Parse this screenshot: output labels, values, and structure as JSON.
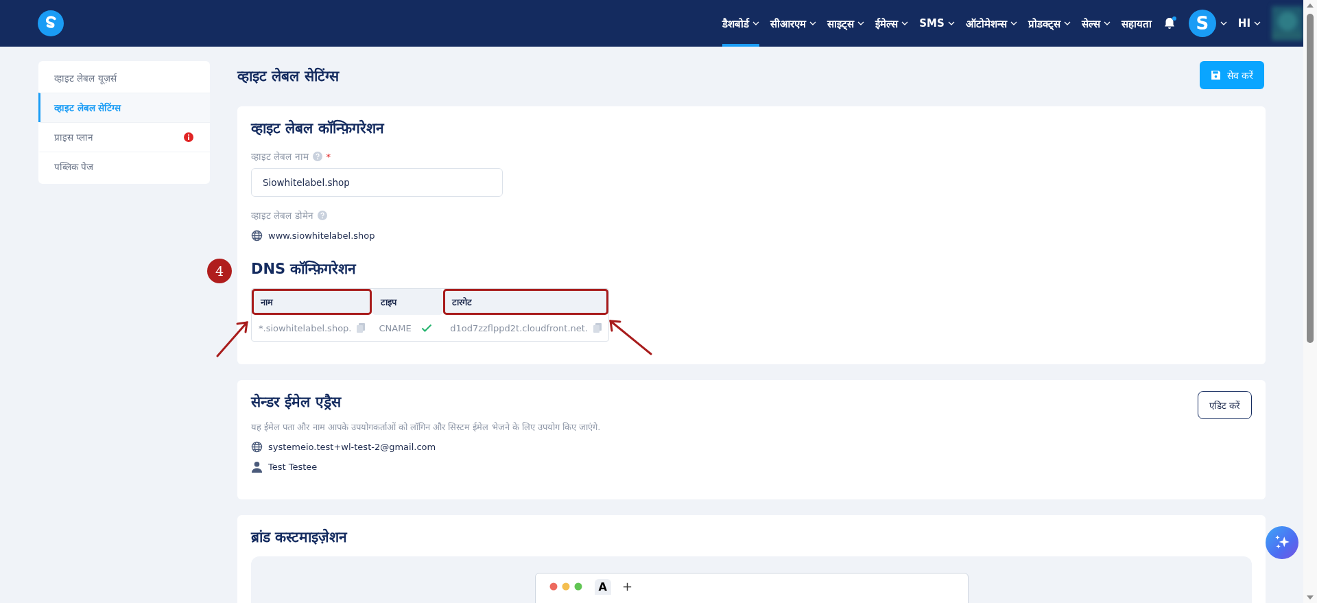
{
  "nav": {
    "items": [
      {
        "label": "डैशबोर्ड",
        "selected": true
      },
      {
        "label": "सीआरएम",
        "selected": false
      },
      {
        "label": "साइट्स",
        "selected": false
      },
      {
        "label": "ईमेल्स",
        "selected": false
      },
      {
        "label": "SMS",
        "selected": false
      },
      {
        "label": "ऑटोमेशन्स",
        "selected": false
      },
      {
        "label": "प्रोडक्ट्स",
        "selected": false
      },
      {
        "label": "सेल्स",
        "selected": false
      }
    ],
    "help": "सहायता",
    "avatar_letter": "S",
    "user": "HI"
  },
  "sidebar": {
    "items": [
      {
        "label": "व्हाइट लेबल यूज़र्स",
        "selected": false,
        "alert": false
      },
      {
        "label": "व्हाइट लेबल सेटिंग्स",
        "selected": true,
        "alert": false
      },
      {
        "label": "प्राइस प्लान",
        "selected": false,
        "alert": true
      },
      {
        "label": "पब्लिक पेज",
        "selected": false,
        "alert": false
      }
    ]
  },
  "page": {
    "title": "व्हाइट लेबल सेटिंग्स",
    "save_button": "सेव करें"
  },
  "config": {
    "title": "व्हाइट लेबल कॉन्फ़िगरेशन",
    "name_label": "व्हाइट लेबल नाम",
    "required_mark": "*",
    "name_value": "Siowhitelabel.shop",
    "domain_label": "व्हाइट लेबल डोमेन",
    "domain_value": "www.siowhitelabel.shop"
  },
  "dns": {
    "step": "4",
    "title": "DNS कॉन्फ़िगरेशन",
    "columns": [
      {
        "label": "नाम",
        "highlighted": true
      },
      {
        "label": "टाइप",
        "highlighted": false
      },
      {
        "label": "टारगेट",
        "highlighted": true
      }
    ],
    "rows": [
      {
        "name": "*.siowhitelabel.shop.",
        "type": "CNAME",
        "verified": true,
        "target": "d1od7zzflppd2t.cloudfront.net."
      }
    ]
  },
  "sender": {
    "title": "सेन्डर ईमेल एड्रैस",
    "description": "यह ईमेल पता और नाम आपके उपयोगकर्ताओं को लॉगिन और सिस्टम ईमेल भेजने के लिए उपयोग किए जाएंगे.",
    "email": "systemeio.test+wl-test-2@gmail.com",
    "name": "Test Testee",
    "edit_button": "एडिट करें"
  },
  "brand": {
    "title": "ब्रांड कस्टमाइज़ेशन",
    "tab_label": "A",
    "new_tab": "+"
  }
}
